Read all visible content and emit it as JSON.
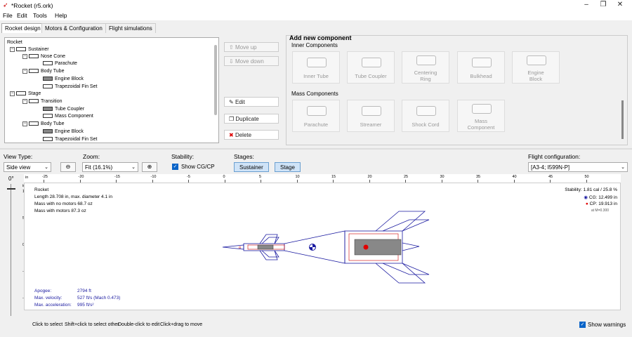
{
  "window": {
    "title": "*Rocket (r5.ork)",
    "controls": [
      "–",
      "❐",
      "✕"
    ]
  },
  "menu": [
    "File",
    "Edit",
    "Tools",
    "Help"
  ],
  "tabs": [
    "Rocket design",
    "Motors & Configuration",
    "Flight simulations"
  ],
  "tree": {
    "items": [
      {
        "label": "Rocket",
        "depth": 0
      },
      {
        "label": "Sustainer",
        "depth": 1
      },
      {
        "label": "Nose Cone",
        "depth": 2
      },
      {
        "label": "Parachute",
        "depth": 3
      },
      {
        "label": "Body Tube",
        "depth": 2
      },
      {
        "label": "Engine Block",
        "depth": 3
      },
      {
        "label": "Trapezoidal Fin Set",
        "depth": 3
      },
      {
        "label": "Stage",
        "depth": 1
      },
      {
        "label": "Transition",
        "depth": 2
      },
      {
        "label": "Tube Coupler",
        "depth": 3
      },
      {
        "label": "Mass Component",
        "depth": 3
      },
      {
        "label": "Body Tube",
        "depth": 2
      },
      {
        "label": "Engine Block",
        "depth": 3
      },
      {
        "label": "Trapezoidal Fin Set",
        "depth": 3
      }
    ]
  },
  "side_buttons": {
    "move_up": "Move up",
    "move_down": "Move down",
    "edit": "Edit",
    "duplicate": "Duplicate",
    "delete": "Delete"
  },
  "add_component": {
    "title": "Add new component",
    "inner_title": "Inner Components",
    "inner": [
      "Inner Tube",
      "Tube Coupler",
      "Centering Ring",
      "Bulkhead",
      "Engine Block"
    ],
    "mass_title": "Mass Components",
    "mass": [
      "Parachute",
      "Streamer",
      "Shock Cord",
      "Mass Component"
    ]
  },
  "controls": {
    "view_type_label": "View Type:",
    "view_type_value": "Side view",
    "zoom_label": "Zoom:",
    "zoom_value": "Fit (16.1%)",
    "stability_label": "Stability:",
    "show_cgcp": "Show CG/CP",
    "stages_label": "Stages:",
    "stage_buttons": [
      "Sustainer",
      "Stage"
    ],
    "flight_config_label": "Flight configuration:",
    "flight_config_value": "[A3-4; I599N-P]"
  },
  "figure": {
    "rotation": "0°",
    "ruler_unit_top": "in",
    "ruler_unit_left": "in",
    "ruler_top_ticks": [
      "-25",
      "-20",
      "-15",
      "-10",
      "-5",
      "0",
      "5",
      "10",
      "15",
      "20",
      "25",
      "30",
      "35",
      "40",
      "45",
      "50"
    ],
    "ruler_left_ticks": [
      "10",
      "5",
      "0",
      "-5",
      "-10"
    ],
    "rocket_name": "Rocket",
    "length_line": "Length 28.708 in, max. diameter 4.1 in",
    "mass_no_motors": "Mass with no motors 68.7 oz",
    "mass_with_motors": "Mass with motors 87.3 oz",
    "stability": "Stability: 1.81 cal / 25.8 %",
    "cg": "CG: 12.499 in",
    "cp": "CP: 19.913 in",
    "aoa": "at M=0.300",
    "apogee_label": "Apogee:",
    "apogee_value": "2794 ft",
    "velocity_label": "Max. velocity:",
    "velocity_value": "527 ft/s  (Mach 0.473)",
    "accel_label": "Max. acceleration:",
    "accel_value": "995 ft/s²"
  },
  "status": {
    "hints": [
      "Click to select",
      "Shift+click to select other",
      "Double-click to edit",
      "Click+drag to move"
    ],
    "show_warnings": "Show warnings"
  },
  "colors": {
    "outline": "#1a1aa0",
    "cp": "#e00000",
    "selected_tab": "#cfe3f7"
  }
}
